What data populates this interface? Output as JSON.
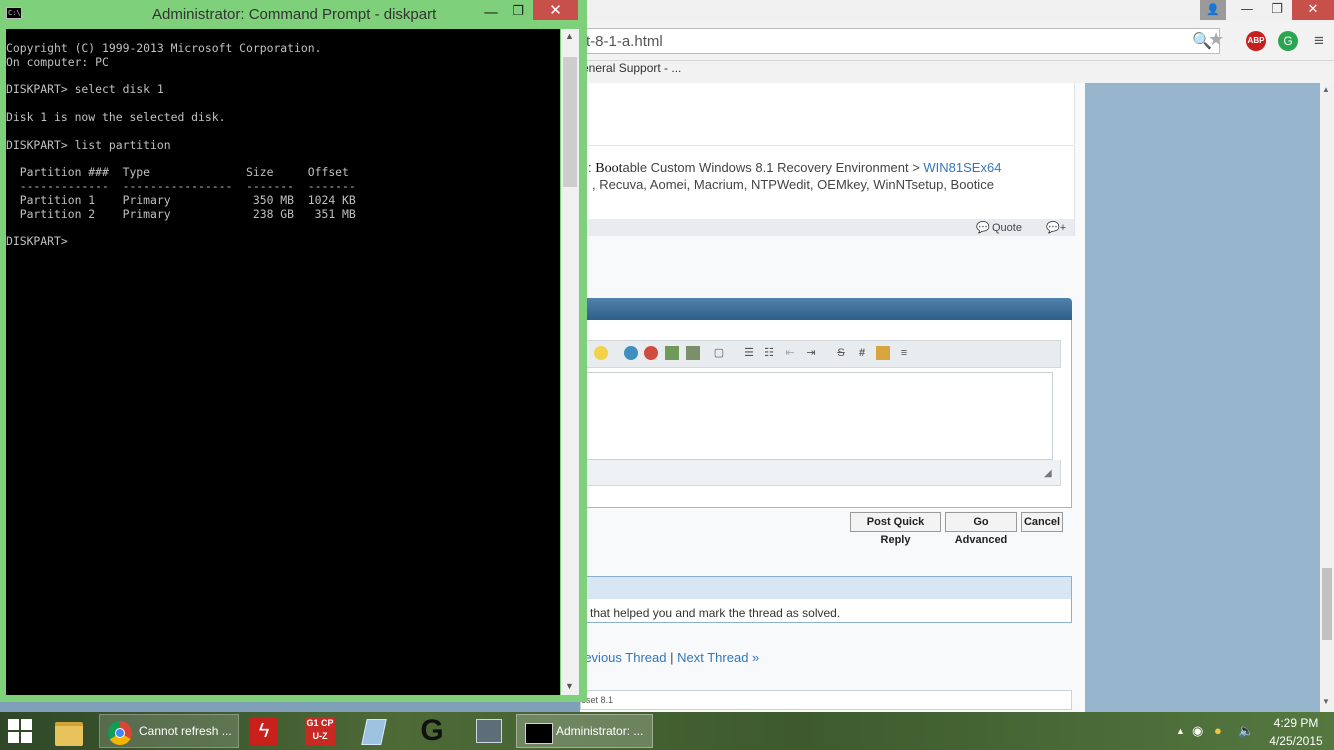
{
  "browser": {
    "url_text": "t-8-1-a.html",
    "bookmarks": [
      "eneral Support - ..."
    ],
    "window_controls": {
      "user": "👤",
      "minimize": "—",
      "maximize": "❐",
      "close": "✕"
    },
    "extensions": {
      "abp": "ABP",
      "ext": "G"
    }
  },
  "forum": {
    "signature_line1": {
      "prefix": ": ",
      "bold": "Boot",
      "middle": "able Custom Windows 8.1 Recovery Environment > ",
      "link": "WIN81SEx64"
    },
    "signature_line2": ", Recuva, Aomei, Macrium, NTPWedit, OEMkey, WinNTsetup, Bootice",
    "quote_label": "Quote",
    "buttons": {
      "post_quick_reply": "Post Quick Reply",
      "go_advanced": "Go Advanced",
      "cancel": "Cancel"
    },
    "notice_text": "that helped you and mark the thread as solved.",
    "thread_nav": {
      "previous": "revious Thread",
      "separator": "|",
      "next": "Next Thread",
      "next_arrow": "»"
    },
    "breadcrumb": "eset 8.1"
  },
  "cmd": {
    "title": "Administrator: Command Prompt - diskpart",
    "icon_text": "C:\\_",
    "lines": [
      "Copyright (C) 1999-2013 Microsoft Corporation.",
      "On computer: PC",
      "",
      "DISKPART> select disk 1",
      "",
      "Disk 1 is now the selected disk.",
      "",
      "DISKPART> list partition",
      "",
      "  Partition ###  Type              Size     Offset",
      "  -------------  ----------------  -------  -------",
      "  Partition 1    Primary            350 MB  1024 KB",
      "  Partition 2    Primary            238 GB   351 MB",
      "",
      "DISKPART>"
    ]
  },
  "taskbar": {
    "chrome_label": "Cannot refresh ...",
    "cmd_label": "Administrator: ...",
    "cpuz_label": "G1 CPU-Z",
    "time": "4:29 PM",
    "date": "4/25/2015"
  },
  "colors": {
    "cmd_frame": "#7ed17a",
    "close_button": "#c7504b",
    "link": "#3377bb",
    "forum_header": "#2e5f89"
  }
}
